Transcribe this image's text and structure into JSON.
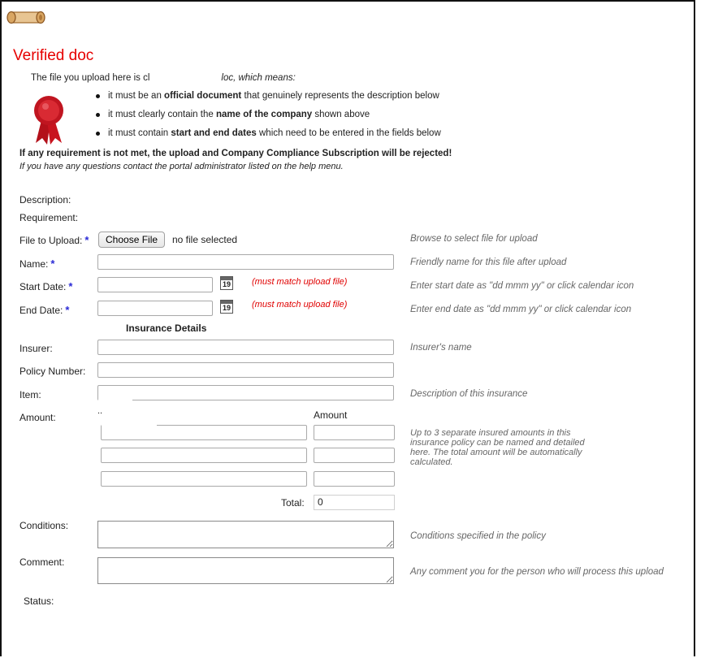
{
  "header": {
    "title": "Verified doc",
    "intro_prefix": "The file you upload here is cl",
    "intro_suffix": "loc, which means:"
  },
  "requirements": [
    {
      "pre": "it must be an ",
      "bold": "official document",
      "post": " that genuinely represents the description below"
    },
    {
      "pre": "it must clearly contain the ",
      "bold": "name of the company",
      "post": " shown above"
    },
    {
      "pre": "it must contain ",
      "bold": "start and end dates",
      "post": " which need to be entered in the fields below"
    }
  ],
  "warning": "If any requirement is not met, the upload and Company Compliance Subscription will be rejected!",
  "question": "If you have any questions contact the portal administrator listed on the help menu.",
  "form": {
    "description_label": "Description:",
    "requirement_label": "Requirement:",
    "file_label": "File to Upload:",
    "choose_file": "Choose File",
    "no_file": "no file selected",
    "file_hint": "Browse to select file for upload",
    "name_label": "Name:",
    "name_hint": "Friendly name for this file after upload",
    "start_label": "Start Date:",
    "start_hint": "Enter start date as \"dd mmm yy\" or click calendar icon",
    "end_label": "End Date:",
    "end_hint": "Enter end date as \"dd mmm yy\" or click calendar icon",
    "must_match": "(must match upload file)",
    "calendar_day": "19",
    "star": "*",
    "insurance_title": "Insurance Details",
    "insurer_label": "Insurer:",
    "insurer_hint": "Insurer's name",
    "policy_label": "Policy Number:",
    "item_label": "Item:",
    "item_hint": "Description of this insurance",
    "amount_label": "Amount:",
    "amount_col_header": "Amount",
    "amount_hint": "Up to 3 separate insured amounts in this insurance policy can be named and detailed here. The total amount will be automatically calculated.",
    "total_label": "Total:",
    "total_value": "0",
    "conditions_label": "Conditions:",
    "conditions_hint": "Conditions specified in the policy",
    "comment_label": "Comment:",
    "comment_hint": "Any comment you for the person who will process this upload",
    "status_label": "Status:"
  }
}
